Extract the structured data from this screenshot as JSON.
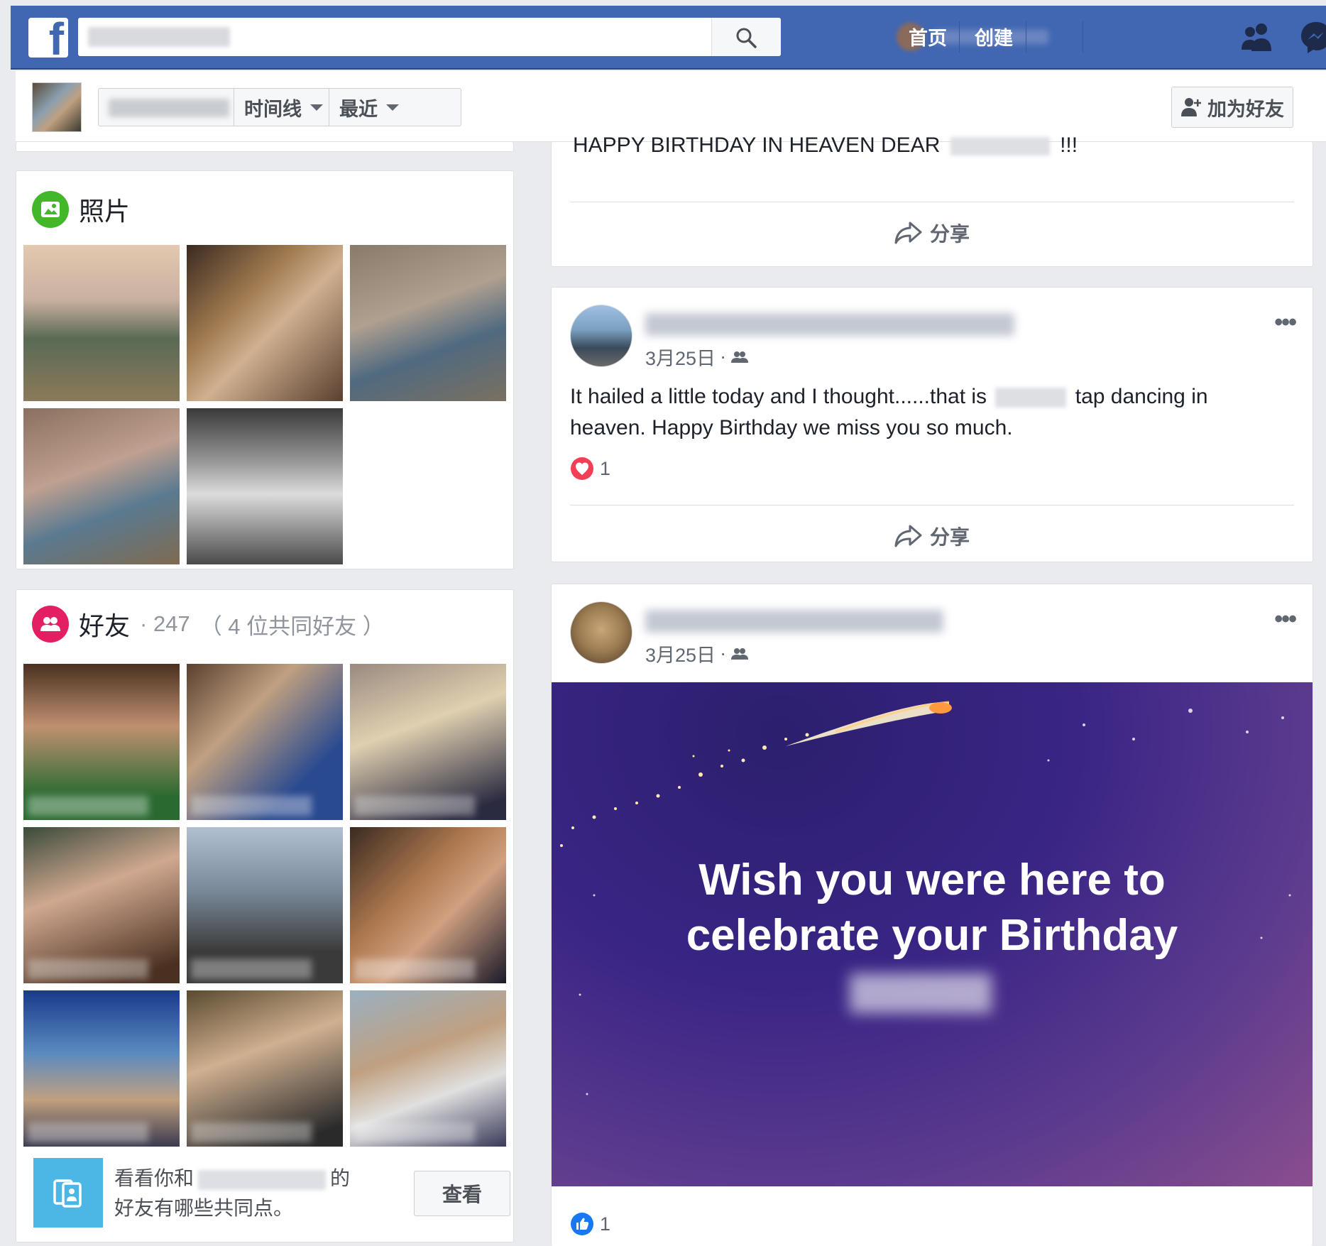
{
  "colors": {
    "brand": "#4267b2",
    "photos_icon": "#42b72a",
    "friends_icon": "#e41e63",
    "love_reaction": "#f33e58",
    "like_reaction": "#1877f2",
    "common_friends_icon": "#4cb6e5"
  },
  "topbar": {
    "logo": "f",
    "icons": [
      "search-icon",
      "friends-icon",
      "messenger-icon"
    ],
    "nav": {
      "home": "首页",
      "create": "创建"
    }
  },
  "subheader": {
    "timeline_label": "时间线",
    "recent_label": "最近",
    "add_friend_label": "加为好友"
  },
  "photos_card": {
    "title": "照片"
  },
  "friends_card": {
    "title": "好友",
    "count": "· 247",
    "mutual": "（ 4 位共同好友 ）",
    "common_text_before": "看看你和",
    "common_text_after": "的",
    "common_text_line2": "好友有哪些共同点。",
    "view_label": "查看"
  },
  "posts": [
    {
      "text": "HAPPY BIRTHDAY IN HEAVEN DEAR",
      "text_suffix": "!!!",
      "share_label": "分享"
    },
    {
      "date": "3月25日",
      "separator": "·",
      "body_before": "It hailed a little today and I thought......that is",
      "body_after": "tap dancing in heaven. Happy Birthday we miss you so much.",
      "reaction_count": "1",
      "share_label": "分享"
    },
    {
      "date": "3月25日",
      "separator": "·",
      "card_line1": "Wish you were here to",
      "card_line2": "celebrate your Birthday",
      "reaction_count": "1"
    }
  ]
}
